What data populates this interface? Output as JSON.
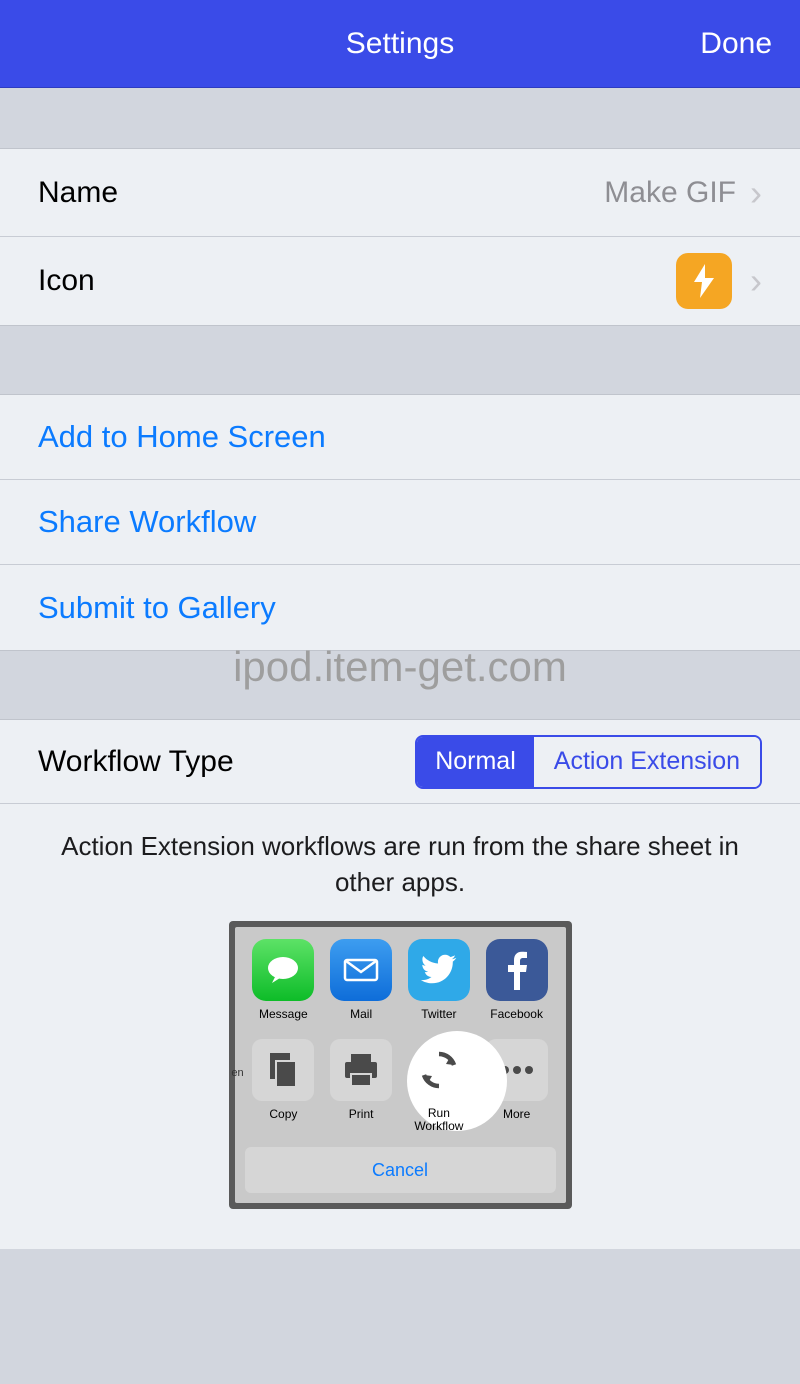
{
  "header": {
    "title": "Settings",
    "done": "Done"
  },
  "group1": {
    "name_label": "Name",
    "name_value": "Make GIF",
    "icon_label": "Icon"
  },
  "actions": {
    "add_home": "Add to Home Screen",
    "share": "Share Workflow",
    "submit": "Submit to Gallery"
  },
  "watermark": "ipod.item-get.com",
  "workflow_type": {
    "label": "Workflow Type",
    "normal": "Normal",
    "action_ext": "Action Extension",
    "description": "Action Extension workflows are run from the share sheet in other apps."
  },
  "share_sheet": {
    "message": "Message",
    "mail": "Mail",
    "twitter": "Twitter",
    "facebook": "Facebook",
    "copy": "Copy",
    "print": "Print",
    "run_workflow": "Run Workflow",
    "more": "More",
    "cancel": "Cancel",
    "en": "en"
  }
}
